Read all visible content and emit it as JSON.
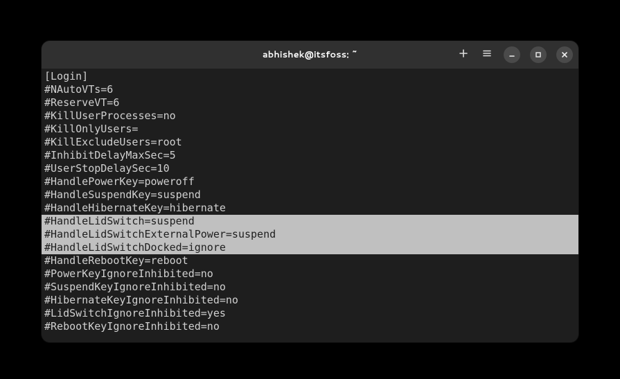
{
  "title": "abhishek@itsfoss: ~",
  "lines": [
    {
      "text": "[Login]",
      "hl": false
    },
    {
      "text": "#NAutoVTs=6",
      "hl": false
    },
    {
      "text": "#ReserveVT=6",
      "hl": false
    },
    {
      "text": "#KillUserProcesses=no",
      "hl": false
    },
    {
      "text": "#KillOnlyUsers=",
      "hl": false
    },
    {
      "text": "#KillExcludeUsers=root",
      "hl": false
    },
    {
      "text": "#InhibitDelayMaxSec=5",
      "hl": false
    },
    {
      "text": "#UserStopDelaySec=10",
      "hl": false
    },
    {
      "text": "#HandlePowerKey=poweroff",
      "hl": false
    },
    {
      "text": "#HandleSuspendKey=suspend",
      "hl": false
    },
    {
      "text": "#HandleHibernateKey=hibernate",
      "hl": false
    },
    {
      "text": "#HandleLidSwitch=suspend",
      "hl": true
    },
    {
      "text": "#HandleLidSwitchExternalPower=suspend",
      "hl": true
    },
    {
      "text": "#HandleLidSwitchDocked=ignore",
      "hl": true
    },
    {
      "text": "#HandleRebootKey=reboot",
      "hl": false
    },
    {
      "text": "#PowerKeyIgnoreInhibited=no",
      "hl": false
    },
    {
      "text": "#SuspendKeyIgnoreInhibited=no",
      "hl": false
    },
    {
      "text": "#HibernateKeyIgnoreInhibited=no",
      "hl": false
    },
    {
      "text": "#LidSwitchIgnoreInhibited=yes",
      "hl": false
    },
    {
      "text": "#RebootKeyIgnoreInhibited=no",
      "hl": false
    }
  ]
}
